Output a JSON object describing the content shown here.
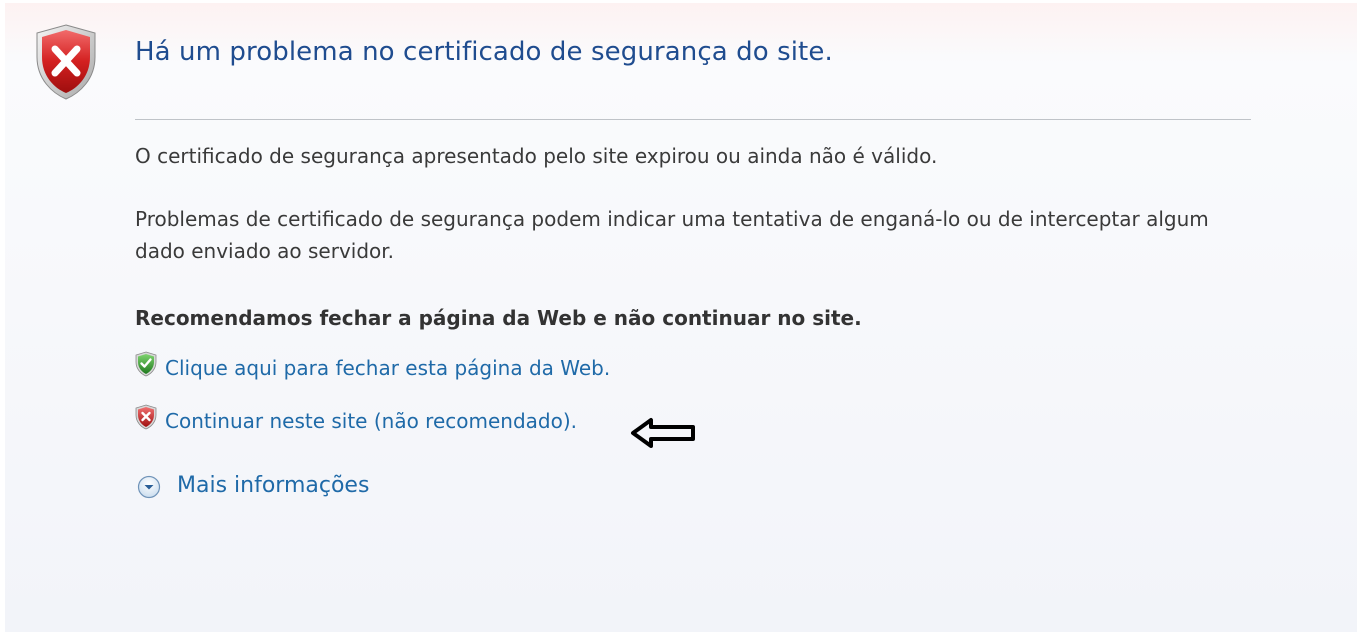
{
  "header": {
    "title": "Há um problema no certificado de segurança do site."
  },
  "body": {
    "paragraph1": "O certificado de segurança apresentado pelo site expirou ou ainda não é válido.",
    "paragraph2": "Problemas de certificado de segurança podem indicar uma tentativa de enganá-lo ou de interceptar algum dado enviado ao servidor.",
    "recommendation": "Recomendamos fechar a página da Web e não continuar no site."
  },
  "actions": {
    "close_link": "Clique aqui para fechar esta página da Web.",
    "continue_link": "Continuar neste site (não recomendado).",
    "more_info": "Mais informações"
  },
  "icons": {
    "header_icon": "red-shield-x-icon",
    "close_icon": "green-shield-check-icon",
    "continue_icon": "red-shield-x-icon",
    "annotation": "left-arrow-icon",
    "more_info_icon": "chevron-down-circle-icon"
  },
  "colors": {
    "title": "#1f4c8f",
    "link": "#1f6aa8",
    "danger": "#c62828",
    "safe": "#2e8b2e"
  }
}
